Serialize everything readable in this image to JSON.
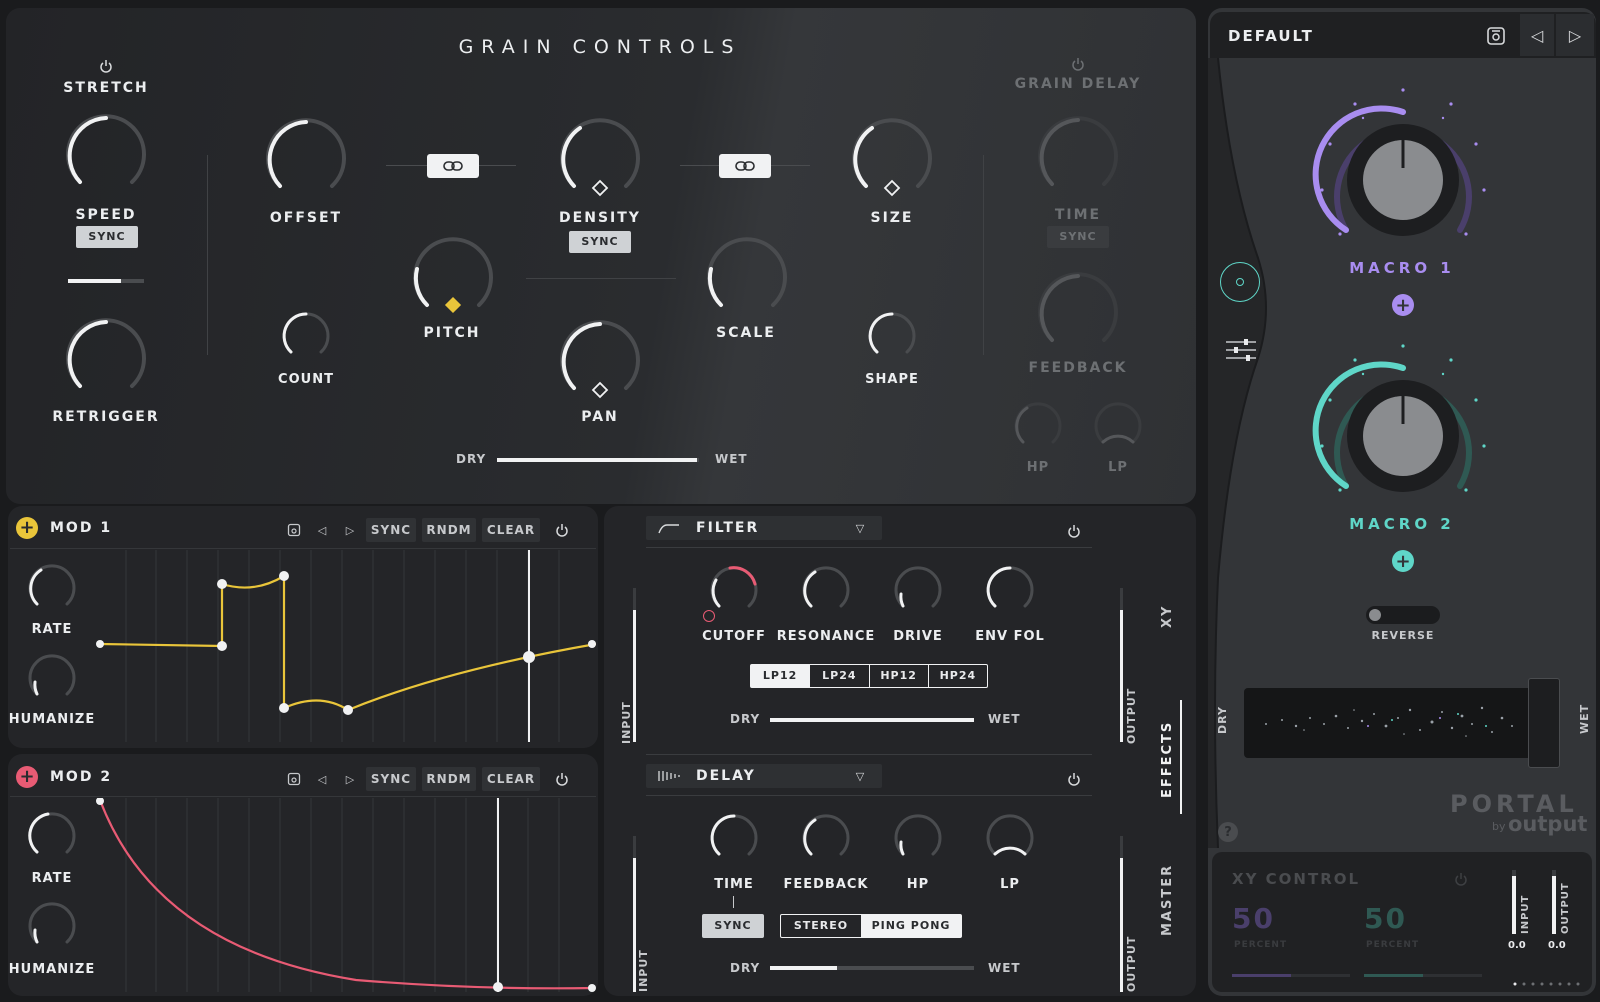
{
  "grain": {
    "title": "GRAIN CONTROLS",
    "stretch": "STRETCH",
    "speed": "SPEED",
    "speed_sync": "SYNC",
    "retrigger": "RETRIGGER",
    "offset": "OFFSET",
    "count": "COUNT",
    "pitch": "PITCH",
    "density": "DENSITY",
    "density_sync": "SYNC",
    "pan": "PAN",
    "scale": "SCALE",
    "size": "SIZE",
    "shape": "SHAPE",
    "dry": "DRY",
    "wet": "WET",
    "dry_wet_value": 0.99
  },
  "grain_delay": {
    "title": "GRAIN DELAY",
    "time": "TIME",
    "sync": "SYNC",
    "feedback": "FEEDBACK",
    "hp": "HP",
    "lp": "LP"
  },
  "mod1": {
    "name": "MOD 1",
    "accent": "#e9c53a",
    "sync": "SYNC",
    "rndm": "RNDM",
    "clear": "CLEAR",
    "rate": "RATE",
    "humanize": "HUMANIZE"
  },
  "mod2": {
    "name": "MOD 2",
    "accent": "#e85b74",
    "sync": "SYNC",
    "rndm": "RNDM",
    "clear": "CLEAR",
    "rate": "RATE",
    "humanize": "HUMANIZE"
  },
  "filter": {
    "name": "FILTER",
    "cutoff": "CUTOFF",
    "resonance": "RESONANCE",
    "drive": "DRIVE",
    "env_fol": "ENV FOL",
    "types": [
      "LP12",
      "LP24",
      "HP12",
      "HP24"
    ],
    "selected_type": "LP12",
    "dry": "DRY",
    "wet": "WET",
    "input": "INPUT",
    "output": "OUTPUT"
  },
  "delay": {
    "name": "DELAY",
    "time": "TIME",
    "feedback": "FEEDBACK",
    "hp": "HP",
    "lp": "LP",
    "sync": "SYNC",
    "stereo": "STEREO",
    "ping_pong": "PING PONG",
    "selected_mode": "STEREO",
    "dry": "DRY",
    "wet": "WET",
    "dry_wet_value": 0.33,
    "input": "INPUT",
    "output": "OUTPUT"
  },
  "side_tabs": {
    "xy": "XY",
    "effects": "EFFECTS",
    "master": "MASTER"
  },
  "preset": {
    "name": "DEFAULT"
  },
  "macros": {
    "macro1": "MACRO 1",
    "macro1_color": "#a98df0",
    "macro2": "MACRO 2",
    "macro2_color": "#5fd6c8"
  },
  "reverse": "REVERSE",
  "dry": "DRY",
  "wet": "WET",
  "logo": {
    "brand": "PORTAL",
    "by": "by",
    "company": "output"
  },
  "help": "?",
  "xy_control": {
    "title": "XY CONTROL",
    "x_value": "50",
    "x_unit": "PERCENT",
    "y_value": "50",
    "y_unit": "PERCENT",
    "input": "INPUT",
    "output": "OUTPUT",
    "input_value": "0.0",
    "output_value": "0.0"
  },
  "icons": [
    "power-icon",
    "link-icon",
    "save-icon",
    "prev-arrow-icon",
    "next-arrow-icon",
    "plus-icon",
    "dropdown-icon",
    "filter-shape-icon",
    "delay-shape-icon",
    "xy-pad-icon",
    "sliders-icon"
  ]
}
